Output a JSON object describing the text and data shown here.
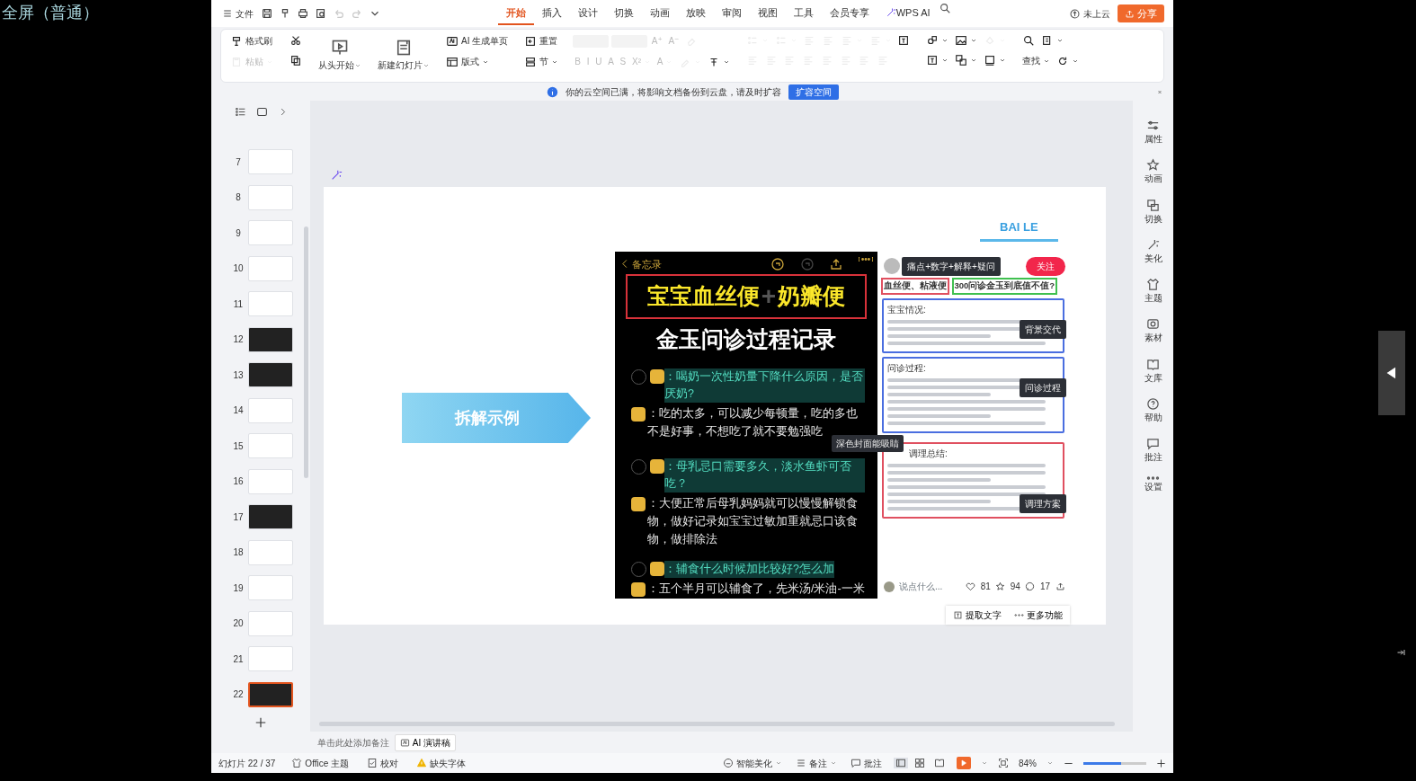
{
  "player": {
    "mode_label": "全屏（普通）"
  },
  "menubar": {
    "file_menu": "文件",
    "quick_icons": [
      {
        "kind": "save",
        "disabled": false
      },
      {
        "kind": "format",
        "disabled": false
      },
      {
        "kind": "print",
        "disabled": false
      },
      {
        "kind": "preview",
        "disabled": false
      },
      {
        "kind": "undo",
        "disabled": true
      },
      {
        "kind": "redo",
        "disabled": true
      },
      {
        "kind": "down",
        "disabled": false
      }
    ],
    "tabs": [
      {
        "label": "开始",
        "selected": true,
        "kind": "text"
      },
      {
        "label": "插入",
        "selected": false,
        "kind": "text"
      },
      {
        "label": "设计",
        "selected": false,
        "kind": "text"
      },
      {
        "label": "切换",
        "selected": false,
        "kind": "text"
      },
      {
        "label": "动画",
        "selected": false,
        "kind": "text"
      },
      {
        "label": "放映",
        "selected": false,
        "kind": "text"
      },
      {
        "label": "审阅",
        "selected": false,
        "kind": "text"
      },
      {
        "label": "视图",
        "selected": false,
        "kind": "text"
      },
      {
        "label": "工具",
        "selected": false,
        "kind": "text"
      },
      {
        "label": "会员专享",
        "selected": false,
        "kind": "text"
      },
      {
        "label": "WPS AI",
        "selected": false,
        "kind": "ai"
      }
    ],
    "cloud_status": "未上云",
    "share_button": "分享"
  },
  "ribbon": [
    {
      "top": [
        {
          "kind": "paint",
          "label": "格式刷",
          "disabled": false
        }
      ],
      "bottom": [
        {
          "kind": "paste",
          "label": "粘贴",
          "disabled": true,
          "dropdown": true
        }
      ]
    },
    {
      "top": [
        {
          "kind": "cut",
          "disabled": false
        }
      ],
      "bottom": [
        {
          "kind": "copy",
          "disabled": false
        }
      ]
    },
    {
      "large": {
        "kind": "play",
        "label": "从头开始",
        "dropdown": true,
        "disabled": false
      }
    },
    {
      "large": {
        "kind": "newslide",
        "label": "新建幻灯片",
        "dropdown": true,
        "disabled": false
      }
    },
    {
      "top": [
        {
          "kind": "ai",
          "label": "AI 生成单页",
          "disabled": false
        }
      ],
      "bottom": [
        {
          "kind": "layout",
          "label": "版式",
          "dropdown": true,
          "disabled": false
        }
      ]
    },
    {
      "top": [
        {
          "kind": "reset",
          "label": "重置",
          "disabled": false
        }
      ],
      "bottom": [
        {
          "kind": "section",
          "label": "节",
          "dropdown": true,
          "disabled": false
        }
      ]
    },
    {
      "top": [
        {
          "kind": "field",
          "disabled": true
        },
        {
          "kind": "field",
          "disabled": true
        },
        {
          "kind": "letter",
          "label": "A⁺",
          "disabled": true
        },
        {
          "kind": "letter",
          "label": "A⁻",
          "disabled": true
        },
        {
          "kind": "eraser",
          "disabled": true
        }
      ],
      "bottom": [
        {
          "kind": "letter",
          "label": "B",
          "disabled": true
        },
        {
          "kind": "letter",
          "label": "I",
          "disabled": true
        },
        {
          "kind": "letter",
          "label": "U",
          "disabled": true
        },
        {
          "kind": "letter",
          "label": "A",
          "disabled": true
        },
        {
          "kind": "letter",
          "label": "S",
          "disabled": true
        },
        {
          "kind": "letter",
          "label": "X²",
          "disabled": true,
          "dropdown": true
        },
        {
          "kind": "letter",
          "label": "A",
          "disabled": true,
          "dropdown": true
        },
        {
          "kind": "highlight",
          "disabled": true,
          "dropdown": true
        },
        {
          "kind": "charstyle",
          "disabled": false,
          "dropdown": true
        }
      ]
    },
    {
      "top": [
        {
          "kind": "bullet",
          "disabled": true,
          "dropdown": true
        },
        {
          "kind": "bullet",
          "disabled": true,
          "dropdown": true
        },
        {
          "kind": "align",
          "disabled": true
        },
        {
          "kind": "align",
          "disabled": true
        },
        {
          "kind": "align",
          "disabled": true,
          "dropdown": true
        },
        {
          "kind": "align",
          "disabled": true,
          "dropdown": true
        },
        {
          "kind": "textbox",
          "disabled": false
        }
      ],
      "bottom": [
        {
          "kind": "align",
          "disabled": true
        },
        {
          "kind": "align",
          "disabled": true
        },
        {
          "kind": "align",
          "disabled": true
        },
        {
          "kind": "align",
          "disabled": true
        },
        {
          "kind": "align",
          "disabled": true
        },
        {
          "kind": "align",
          "disabled": true
        },
        {
          "kind": "align",
          "disabled": true
        },
        {
          "kind": "align",
          "disabled": true
        }
      ]
    },
    {
      "top": [
        {
          "kind": "shape",
          "disabled": false,
          "dropdown": true
        },
        {
          "kind": "image",
          "disabled": false,
          "dropdown": true
        },
        {
          "kind": "fill",
          "disabled": true,
          "dropdown": true
        }
      ],
      "bottom": [
        {
          "kind": "textbox",
          "disabled": false,
          "dropdown": true
        },
        {
          "kind": "arrange",
          "disabled": false,
          "dropdown": true
        },
        {
          "kind": "outline",
          "disabled": false,
          "dropdown": true
        }
      ]
    },
    {
      "top": [
        {
          "kind": "search",
          "disabled": false
        },
        {
          "kind": "replace",
          "disabled": false,
          "dropdown": true
        }
      ],
      "bottom": [
        {
          "kind": "text",
          "label": "查找",
          "disabled": false,
          "dropdown": true
        },
        {
          "kind": "refresh",
          "disabled": false,
          "dropdown": true
        }
      ]
    }
  ],
  "notice": {
    "message": "你的云空间已满，将影响文档备份到云盘，请及时扩容",
    "button": "扩容空间"
  },
  "thumbnails": [
    {
      "number": "7",
      "dark": false,
      "selected": false
    },
    {
      "number": "8",
      "dark": false,
      "selected": false
    },
    {
      "number": "9",
      "dark": false,
      "selected": false
    },
    {
      "number": "10",
      "dark": false,
      "selected": false
    },
    {
      "number": "11",
      "dark": false,
      "selected": false
    },
    {
      "number": "12",
      "dark": true,
      "selected": false
    },
    {
      "number": "13",
      "dark": true,
      "selected": false
    },
    {
      "number": "14",
      "dark": false,
      "selected": false
    },
    {
      "number": "15",
      "dark": false,
      "selected": false
    },
    {
      "number": "16",
      "dark": false,
      "selected": false
    },
    {
      "number": "17",
      "dark": true,
      "selected": false
    },
    {
      "number": "18",
      "dark": false,
      "selected": false
    },
    {
      "number": "19",
      "dark": false,
      "selected": false
    },
    {
      "number": "20",
      "dark": false,
      "selected": false
    },
    {
      "number": "21",
      "dark": false,
      "selected": false
    },
    {
      "number": "22",
      "dark": true,
      "selected": true
    }
  ],
  "slide": {
    "brand": "BAI LE",
    "banner": "拆解示例",
    "left_image": {
      "back": "备忘录",
      "title_parts": [
        "宝宝血丝便",
        "+",
        "奶瓣便"
      ],
      "subtitle": "金玉问诊过程记录",
      "qa": [
        {
          "question": "：喝奶一次性奶量下降什么原因，是否厌奶?",
          "answer": "：吃的太多，可以减少每顿量，吃的多也不是好事，不想吃了就不要勉强吃"
        },
        {
          "question": "：母乳忌口需要多久，淡水鱼虾可否吃？",
          "answer": "：大便正常后母乳妈妈就可以慢慢解锁食物，做好记录如宝宝过敏加重就忌口该食物，做排除法"
        },
        {
          "question": "：辅食什么时候加比较好?怎么加",
          "answer": "：五个半月可以辅食了，先米汤/米油-一米"
        }
      ],
      "callout": "深色封面能吸睛"
    },
    "right_image": {
      "badge": "痛点+数字+解释+疑问",
      "follow": "关注",
      "title_tags": [
        {
          "text": "血丝便、粘液便",
          "color": "#e05060"
        },
        {
          "text": "300问诊金玉到底值不值?",
          "color": "#40c050"
        }
      ],
      "sections": [
        {
          "heading": "宝宝情况:",
          "tag": "背景交代",
          "color": "#4a6ee0"
        },
        {
          "heading": "问诊过程:",
          "tag": "问诊过程",
          "color": "#4a6ee0"
        },
        {
          "heading": "调理总结:",
          "tag": "调理方案",
          "color": "#e05060"
        }
      ],
      "comment_placeholder": "说点什么...",
      "likes": "81",
      "stars": "94",
      "comments": "17"
    },
    "tools": [
      "提取文字",
      "更多功能"
    ]
  },
  "sidebar": [
    {
      "kind": "sliders",
      "label": "属性"
    },
    {
      "kind": "star",
      "label": "动画"
    },
    {
      "kind": "swap",
      "label": "切换"
    },
    {
      "kind": "magic",
      "label": "美化"
    },
    {
      "kind": "shirt",
      "label": "主题"
    },
    {
      "kind": "materials",
      "label": "素材"
    },
    {
      "kind": "book",
      "label": "文库"
    },
    {
      "kind": "help",
      "label": "帮助"
    },
    {
      "kind": "comment",
      "label": "批注"
    },
    {
      "kind": "dots",
      "label": "设置"
    }
  ],
  "notes": {
    "placeholder": "单击此处添加备注",
    "ai_button": "AI 演讲稿"
  },
  "status_bar": {
    "slide_count": "幻灯片 22 / 37",
    "theme": "Office 主题",
    "proof": "校对",
    "missing_fonts": "缺失字体",
    "beautify": "智能美化",
    "notes": "备注",
    "comments": "批注",
    "views": [
      {
        "kind": "normal",
        "selected": true
      },
      {
        "kind": "grid",
        "selected": false
      },
      {
        "kind": "read",
        "selected": false
      }
    ],
    "zoom": "84%",
    "zoom_slider": {
      "level": 0.6
    }
  }
}
